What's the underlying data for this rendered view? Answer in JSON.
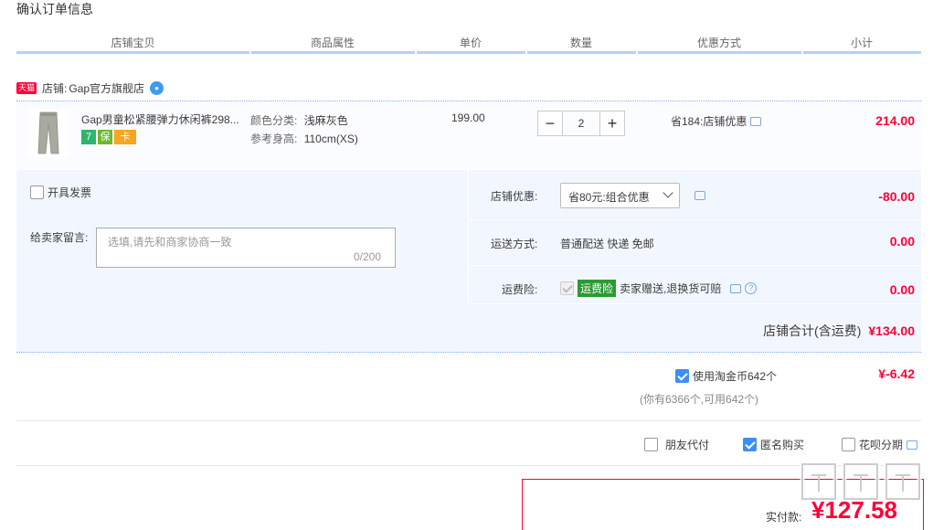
{
  "page_title": "确认订单信息",
  "columns": [
    "店铺宝贝",
    "商品属性",
    "单价",
    "数量",
    "优惠方式",
    "小计"
  ],
  "shop": {
    "badge": "天猫",
    "name_prefix": "店铺:",
    "name": "Gap官方旗舰店"
  },
  "item": {
    "title": "Gap男童松紧腰弹力休闲裤298...",
    "service_icons": [
      "7",
      "保",
      "卡"
    ],
    "attr1_label": "颜色分类:",
    "attr1_value": "浅麻灰色",
    "attr2_label": "参考身高:",
    "attr2_value": "110cm(XS)",
    "unit_price": "199.00",
    "quantity": "2",
    "qty_minus": "−",
    "qty_plus": "+",
    "discount": "省184:店铺优惠",
    "subtotal": "214.00"
  },
  "invoice_label": "开具发票",
  "message": {
    "label": "给卖家留言:",
    "placeholder": "选填,请先和商家协商一致",
    "count": "0/200"
  },
  "shop_discount": {
    "label": "店铺优惠:",
    "selected": "省80元:组合优惠",
    "amount": "-80.00"
  },
  "shipping": {
    "label": "运送方式:",
    "value": "普通配送 快递 免邮",
    "amount": "0.00"
  },
  "insurance": {
    "label": "运费险:",
    "tag": "运费险",
    "text": "卖家赠送,退换货可赔",
    "amount": "0.00"
  },
  "shop_total": {
    "label": "店铺合计(含运费)",
    "amount": "¥134.00"
  },
  "coins": {
    "label": "使用淘金币642个",
    "detail": "(你有6366个,可用642个)",
    "amount": "¥-6.42"
  },
  "options": {
    "friend_pay": "朋友代付",
    "anonymous": "匿名购买",
    "huabei": "花呗分期"
  },
  "payment": {
    "label": "实付款:",
    "amount": "¥127.58"
  },
  "colors": {
    "accent": "#ff0036",
    "blue": "#3d8ef7",
    "panel": "#f2f7ff",
    "header_line": "#b2d1ff"
  }
}
